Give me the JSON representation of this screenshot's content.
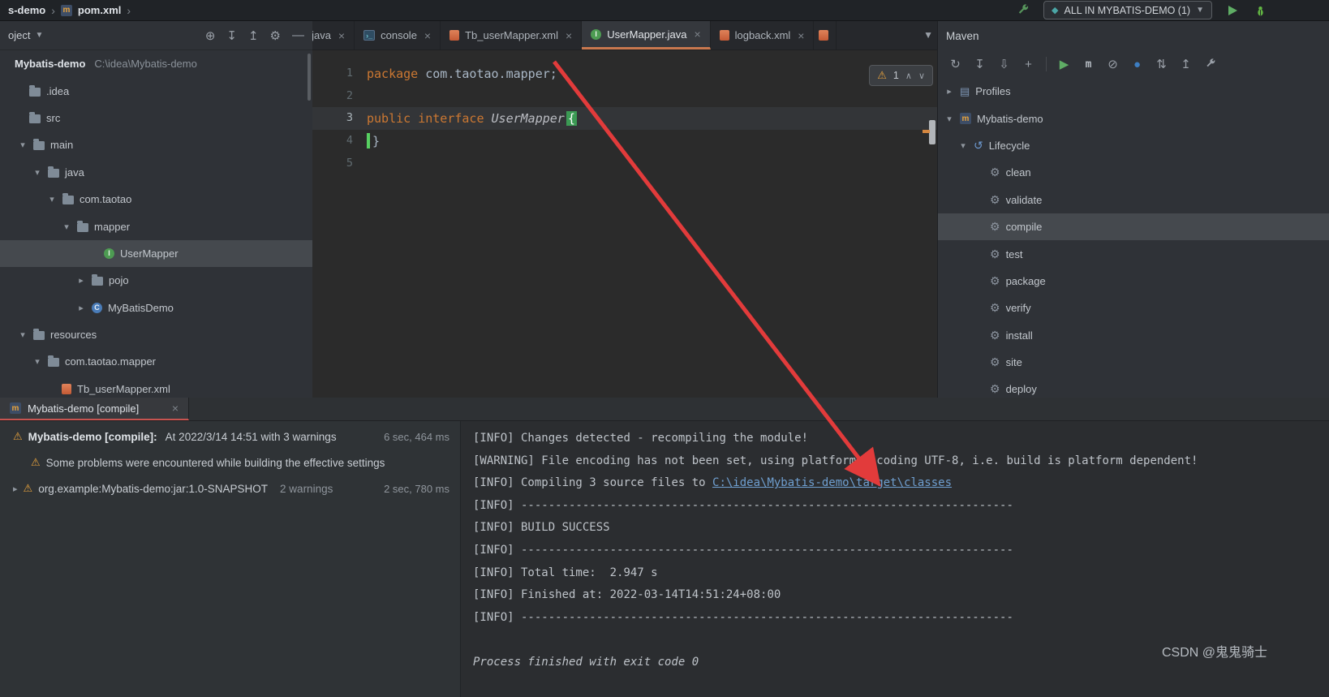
{
  "titlebar": {
    "project": "s-demo",
    "file": "pom.xml",
    "maven_badge": "m",
    "run_config": "ALL IN MYBATIS-DEMO (1)"
  },
  "project": {
    "header": "oject",
    "items": [
      {
        "label": "Mybatis-demo",
        "path": "C:\\idea\\Mybatis-demo"
      },
      {
        "label": ".idea"
      },
      {
        "label": "src"
      },
      {
        "label": "main"
      },
      {
        "label": "java"
      },
      {
        "label": "com.taotao"
      },
      {
        "label": "mapper"
      },
      {
        "label": "UserMapper"
      },
      {
        "label": "pojo"
      },
      {
        "label": "MyBatisDemo"
      },
      {
        "label": "resources"
      },
      {
        "label": "com.taotao.mapper"
      },
      {
        "label": "Tb_userMapper.xml"
      }
    ]
  },
  "tabs": {
    "close": "×",
    "items": [
      {
        "label": "no.java"
      },
      {
        "label": "console"
      },
      {
        "label": "Tb_userMapper.xml"
      },
      {
        "label": "UserMapper.java"
      },
      {
        "label": "logback.xml"
      }
    ]
  },
  "editor": {
    "warning_count": "1",
    "gutter": [
      "1",
      "2",
      "3",
      "4",
      "5"
    ],
    "code": {
      "l1_kw": "package",
      "l1_text": " com.taotao.mapper;",
      "l3_kw": "public interface",
      "l3_name": " UserMapper",
      "l3_brace": "{",
      "l4_brace": "}"
    }
  },
  "maven": {
    "title": "Maven",
    "items": [
      {
        "label": "Profiles"
      },
      {
        "label": "Mybatis-demo"
      },
      {
        "label": "Lifecycle"
      },
      {
        "label": "clean"
      },
      {
        "label": "validate"
      },
      {
        "label": "compile"
      },
      {
        "label": "test"
      },
      {
        "label": "package"
      },
      {
        "label": "verify"
      },
      {
        "label": "install"
      },
      {
        "label": "site"
      },
      {
        "label": "deploy"
      }
    ]
  },
  "bottom": {
    "tab": "Mybatis-demo [compile]",
    "tree": [
      {
        "title": "Mybatis-demo [compile]:",
        "text": " At 2022/3/14 14:51 with 3 warnings",
        "time": "6 sec, 464 ms"
      },
      {
        "text": "Some problems were encountered while building the effective settings"
      },
      {
        "text": "org.example:Mybatis-demo:jar:1.0-SNAPSHOT",
        "badge": "2 warnings",
        "time": "2 sec, 780 ms"
      }
    ],
    "console": [
      {
        "pre": "[INFO]",
        "text": " Changes detected - recompiling the module!"
      },
      {
        "pre": "[WARNING]",
        "text": " File encoding has not been set, using platform encoding UTF-8, i.e. build is platform dependent!"
      },
      {
        "pre": "[INFO]",
        "text": " Compiling 3 source files to ",
        "link": "C:\\idea\\Mybatis-demo\\target\\classes"
      },
      {
        "pre": "[INFO]",
        "text": " ------------------------------------------------------------------------"
      },
      {
        "pre": "[INFO]",
        "text": " BUILD SUCCESS"
      },
      {
        "pre": "[INFO]",
        "text": " ------------------------------------------------------------------------"
      },
      {
        "pre": "[INFO]",
        "text": " Total time:  2.947 s"
      },
      {
        "pre": "[INFO]",
        "text": " Finished at: 2022-03-14T14:51:24+08:00"
      },
      {
        "pre": "[INFO]",
        "text": " ------------------------------------------------------------------------"
      }
    ],
    "exit_line": "Process finished with exit code 0"
  },
  "watermark": "CSDN @鬼鬼骑士"
}
